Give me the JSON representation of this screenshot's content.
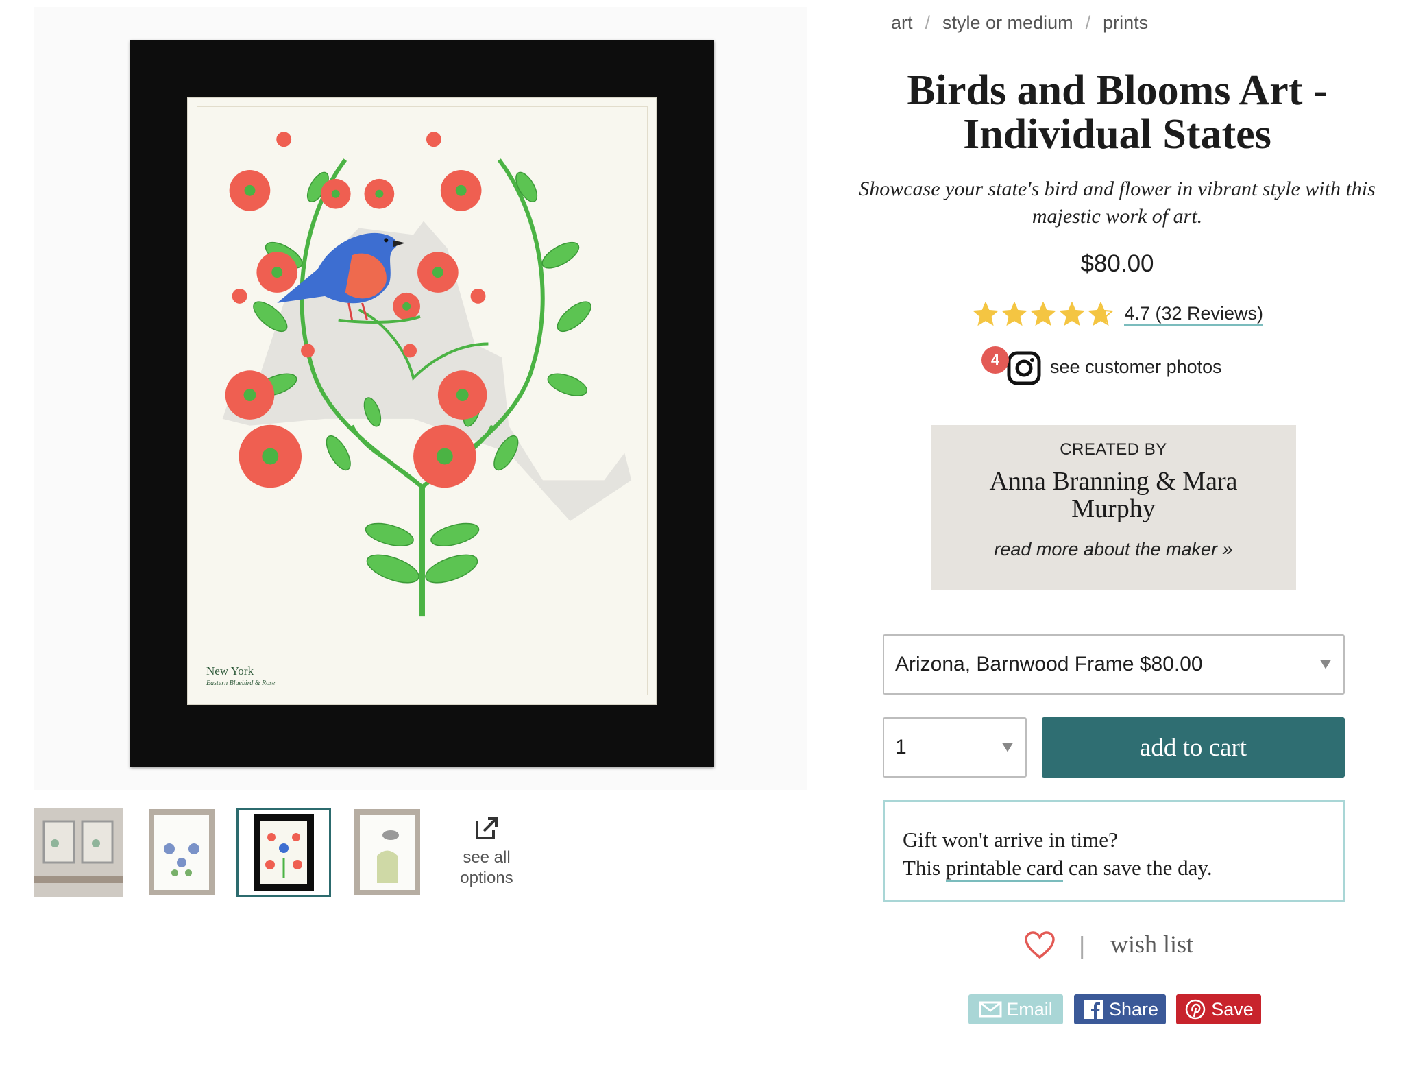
{
  "breadcrumb": [
    {
      "label": "art"
    },
    {
      "label": "style or medium"
    },
    {
      "label": "prints"
    }
  ],
  "product": {
    "title": "Birds and Blooms Art - Individual States",
    "tagline": "Showcase your state's bird and flower in vibrant style with this majestic work of art.",
    "price": "$80.00",
    "rating_value": 4.7,
    "rating_text": "4.7 (32 Reviews)",
    "customer_photos_count": "4",
    "customer_photos_label": "see customer photos"
  },
  "artwork": {
    "state_label": "New York",
    "subtitle": "Eastern Bluebird & Rose"
  },
  "thumbnails": [
    {
      "name": "room-scene"
    },
    {
      "name": "barnwood-frame-bluebonnet"
    },
    {
      "name": "black-frame-new-york",
      "selected": true
    },
    {
      "name": "barnwood-frame-yellow"
    }
  ],
  "see_all_options": "see all options",
  "maker": {
    "created_by": "CREATED BY",
    "name": "Anna Branning & Mara Murphy",
    "read_more": "read more about the maker »"
  },
  "variant_select": {
    "value": "Arizona, Barnwood Frame $80.00"
  },
  "quantity_select": {
    "value": "1"
  },
  "add_to_cart_label": "add to cart",
  "gift": {
    "line1": "Gift won't arrive in time?",
    "line2_before": "This ",
    "line2_link": "printable card",
    "line2_after": " can save the day."
  },
  "wishlist": {
    "separator": "|",
    "label": "wish list"
  },
  "share": {
    "email": "Email",
    "facebook": "Share",
    "pinterest": "Save"
  },
  "colors": {
    "accent_teal": "#2f6e72",
    "light_teal": "#a9d6d6",
    "star_gold": "#f4c542",
    "badge_red": "#e35a55",
    "facebook_blue": "#3b5998",
    "pinterest_red": "#c8232c"
  }
}
